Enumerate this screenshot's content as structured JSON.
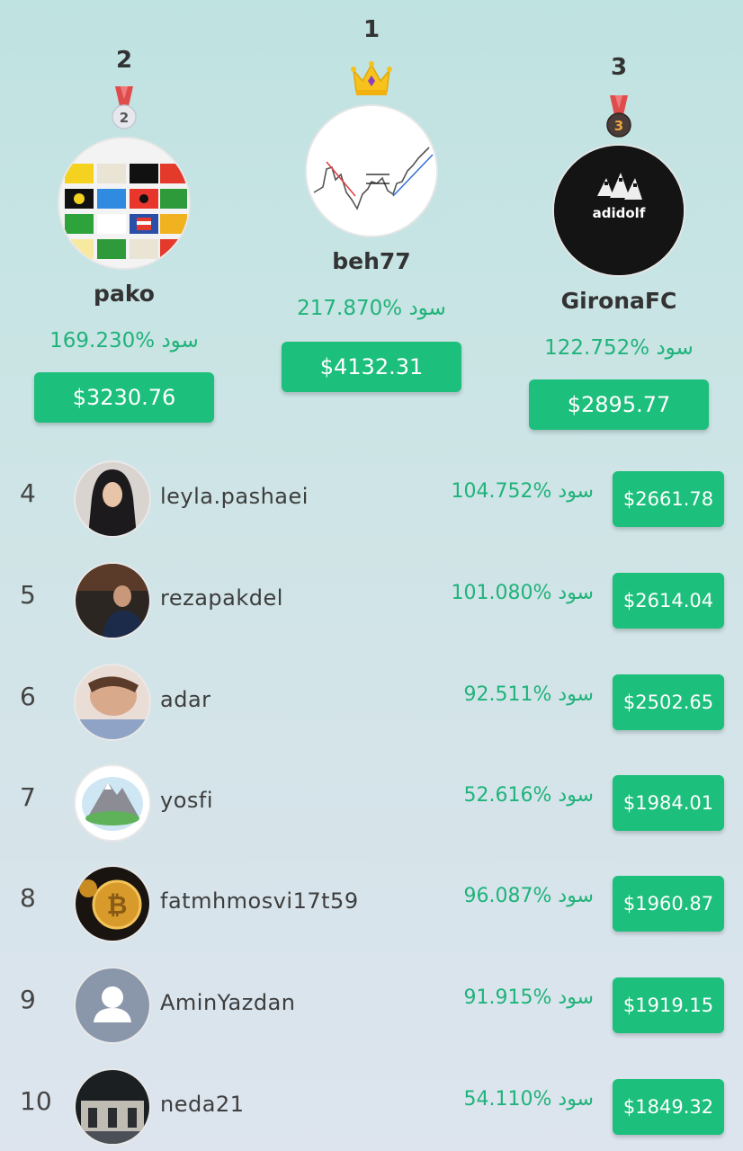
{
  "podium": [
    {
      "rank": "2",
      "name": "pako",
      "profit": "169.230% سود",
      "balance": "$3230.76",
      "medal_number": "2"
    },
    {
      "rank": "1",
      "name": "beh77",
      "profit": "217.870% سود",
      "balance": "$4132.31"
    },
    {
      "rank": "3",
      "name": "GironaFC",
      "profit": "122.752% سود",
      "balance": "$2895.77",
      "medal_number": "3",
      "avatar_text": "adidolf"
    }
  ],
  "leaderboard": [
    {
      "rank": "4",
      "name": "leyla.pashaei",
      "profit": "104.752% سود",
      "balance": "$2661.78"
    },
    {
      "rank": "5",
      "name": "rezapakdel",
      "profit": "101.080% سود",
      "balance": "$2614.04"
    },
    {
      "rank": "6",
      "name": "adar",
      "profit": "92.511% سود",
      "balance": "$2502.65"
    },
    {
      "rank": "7",
      "name": "yosfi",
      "profit": "52.616% سود",
      "balance": "$1984.01"
    },
    {
      "rank": "8",
      "name": "fatmhmosvi17t59",
      "profit": "96.087% سود",
      "balance": "$1960.87"
    },
    {
      "rank": "9",
      "name": "AminYazdan",
      "profit": "91.915% سود",
      "balance": "$1919.15"
    },
    {
      "rank": "10",
      "name": "neda21",
      "profit": "54.110% سود",
      "balance": "$1849.32"
    }
  ],
  "colors": {
    "accent": "#1dbf7c",
    "profit_text": "#1fb37a"
  }
}
